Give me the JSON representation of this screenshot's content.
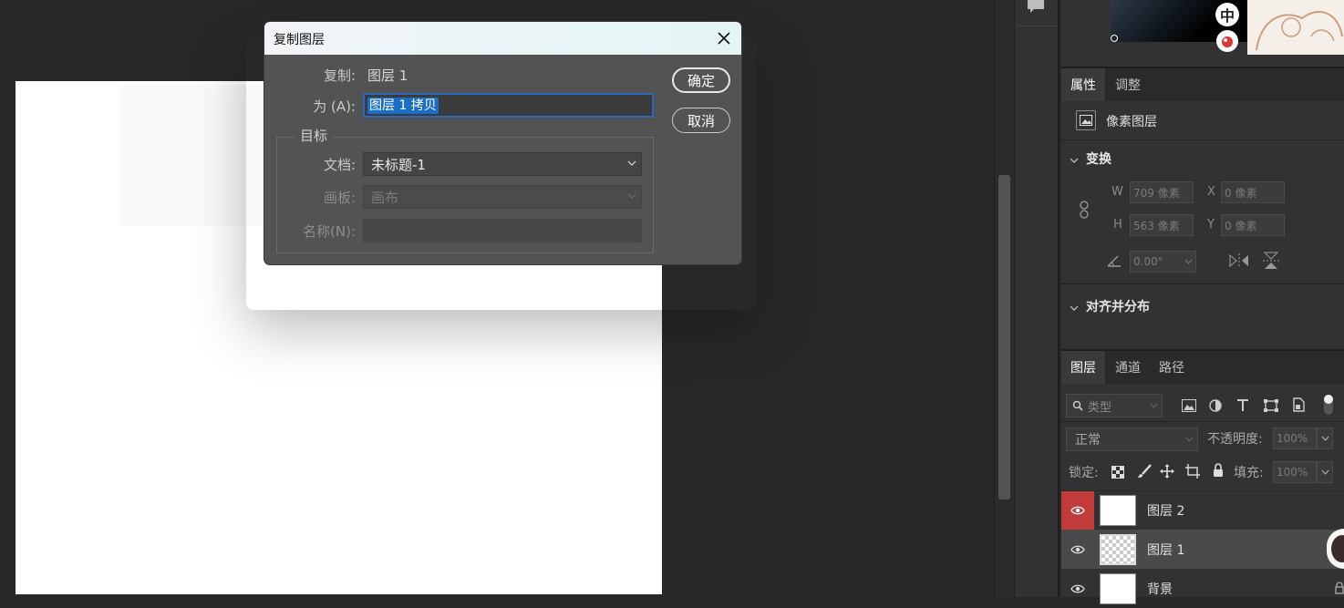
{
  "dialog": {
    "title": "复制图层",
    "duplicate_label": "复制:",
    "duplicate_value": "图层 1",
    "as_label": "为 (A):",
    "as_value": "图层 1 拷贝",
    "ok_label": "确定",
    "cancel_label": "取消",
    "target_group": "目标",
    "document_label": "文档:",
    "document_value": "未标题-1",
    "artboard_label": "画板:",
    "artboard_value": "画布",
    "name_label": "名称(N):",
    "name_value": ""
  },
  "ime": {
    "mode": "中"
  },
  "properties_panel": {
    "tabs": [
      "属性",
      "调整"
    ],
    "layer_type": "像素图层",
    "transform_title": "变换",
    "w_label": "W",
    "w_value": "709 像素",
    "h_label": "H",
    "h_value": "563 像素",
    "x_label": "X",
    "x_value": "0 像素",
    "y_label": "Y",
    "y_value": "0 像素",
    "angle_value": "0.00°",
    "align_title": "对齐并分布"
  },
  "layers_panel": {
    "tabs": [
      "图层",
      "通道",
      "路径"
    ],
    "filter_placeholder": "类型",
    "blend_mode": "正常",
    "opacity_label": "不透明度:",
    "opacity_value": "100%",
    "lock_label": "锁定:",
    "fill_label": "填充:",
    "fill_value": "100%",
    "layers": [
      {
        "name": "图层 2"
      },
      {
        "name": "图层 1"
      },
      {
        "name": "背景"
      }
    ]
  },
  "colors": {
    "accent_blue": "#1a6ec7",
    "eye_active_bg": "#c23b3b",
    "selected_layer_bg": "#4a4a4a"
  }
}
